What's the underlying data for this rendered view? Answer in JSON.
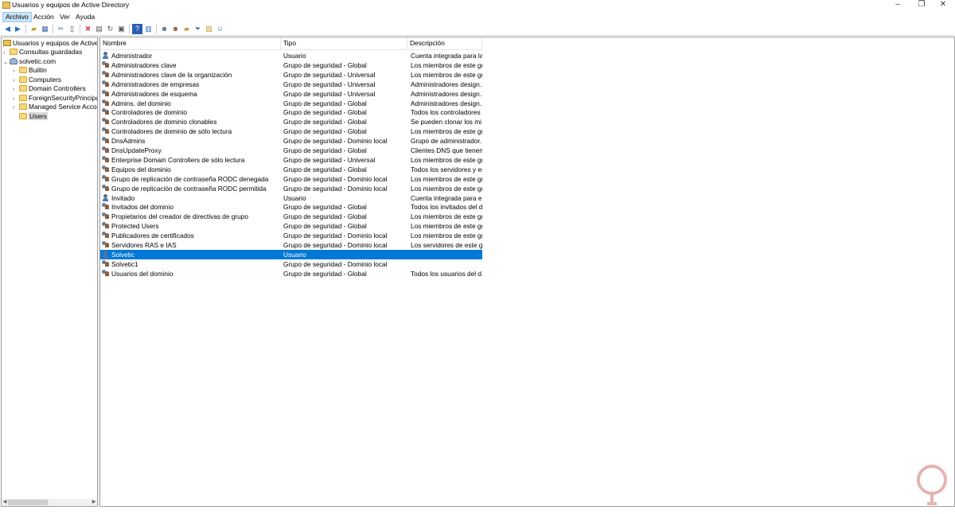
{
  "window": {
    "title": "Usuarios y equipos de Active Directory"
  },
  "menu": [
    "Archivo",
    "Acción",
    "Ver",
    "Ayuda"
  ],
  "tree": {
    "root": "Usuarios y equipos de Active Directory",
    "saved_queries": "Consultas guardadas",
    "domain": "solvetic.com",
    "children": [
      "Builtin",
      "Computers",
      "Domain Controllers",
      "ForeignSecurityPrincipals",
      "Managed Service Accounts",
      "Users"
    ],
    "selected": "Users"
  },
  "columns": [
    "Nombre",
    "Tipo",
    "Descripción"
  ],
  "rows": [
    {
      "icon": "user-icon",
      "name": "Administrador",
      "type": "Usuario",
      "desc": "Cuenta integrada para la..."
    },
    {
      "icon": "group-icon",
      "name": "Administradores clave",
      "type": "Grupo de seguridad - Global",
      "desc": "Los miembros de este gr..."
    },
    {
      "icon": "group-icon",
      "name": "Administradores clave de la organización",
      "type": "Grupo de seguridad - Universal",
      "desc": "Los miembros de este gr..."
    },
    {
      "icon": "group-icon",
      "name": "Administradores de empresas",
      "type": "Grupo de seguridad - Universal",
      "desc": "Administradores design..."
    },
    {
      "icon": "group-icon",
      "name": "Administradores de esquema",
      "type": "Grupo de seguridad - Universal",
      "desc": "Administradores design..."
    },
    {
      "icon": "group-icon",
      "name": "Admins. del dominio",
      "type": "Grupo de seguridad - Global",
      "desc": "Administradores design..."
    },
    {
      "icon": "group-icon",
      "name": "Controladores de dominio",
      "type": "Grupo de seguridad - Global",
      "desc": "Todos los controladores ..."
    },
    {
      "icon": "group-icon",
      "name": "Controladores de dominio clonables",
      "type": "Grupo de seguridad - Global",
      "desc": "Se pueden clonar los mi..."
    },
    {
      "icon": "group-icon",
      "name": "Controladores de dominio de sólo lectura",
      "type": "Grupo de seguridad - Global",
      "desc": "Los miembros de este gr..."
    },
    {
      "icon": "group-icon",
      "name": "DnsAdmins",
      "type": "Grupo de seguridad - Dominio local",
      "desc": "Grupo de administrador..."
    },
    {
      "icon": "group-icon",
      "name": "DnsUpdateProxy",
      "type": "Grupo de seguridad - Global",
      "desc": "Clientes DNS que tienen..."
    },
    {
      "icon": "group-icon",
      "name": "Enterprise Domain Controllers de sólo lectura",
      "type": "Grupo de seguridad - Universal",
      "desc": "Los miembros de este gr..."
    },
    {
      "icon": "group-icon",
      "name": "Equipos del dominio",
      "type": "Grupo de seguridad - Global",
      "desc": "Todos los servidores y es..."
    },
    {
      "icon": "group-icon",
      "name": "Grupo de replicación de contraseña RODC denegada",
      "type": "Grupo de seguridad - Dominio local",
      "desc": "Los miembros de este gr..."
    },
    {
      "icon": "group-icon",
      "name": "Grupo de replicación de contraseña RODC permitida",
      "type": "Grupo de seguridad - Dominio local",
      "desc": "Los miembros de este gr..."
    },
    {
      "icon": "user-icon",
      "name": "Invitado",
      "type": "Usuario",
      "desc": "Cuenta integrada para el..."
    },
    {
      "icon": "group-icon",
      "name": "Invitados del dominio",
      "type": "Grupo de seguridad - Global",
      "desc": "Todos los invitados del d..."
    },
    {
      "icon": "group-icon",
      "name": "Propietarios del creador de directivas de grupo",
      "type": "Grupo de seguridad - Global",
      "desc": "Los miembros de este gr..."
    },
    {
      "icon": "group-icon",
      "name": "Protected Users",
      "type": "Grupo de seguridad - Global",
      "desc": "Los miembros de este gr..."
    },
    {
      "icon": "group-icon",
      "name": "Publicadores de certificados",
      "type": "Grupo de seguridad - Dominio local",
      "desc": "Los miembros de este gr..."
    },
    {
      "icon": "group-icon",
      "name": "Servidores RAS e IAS",
      "type": "Grupo de seguridad - Dominio local",
      "desc": "Los servidores de este gr..."
    },
    {
      "icon": "user-icon",
      "name": "Solvetic",
      "type": "Usuario",
      "desc": "",
      "selected": true
    },
    {
      "icon": "group-icon",
      "name": "Solvetic1",
      "type": "Grupo de seguridad - Dominio local",
      "desc": ""
    },
    {
      "icon": "group-icon",
      "name": "Usuarios del dominio",
      "type": "Grupo de seguridad - Global",
      "desc": "Todos los usuarios del d..."
    }
  ],
  "colors": {
    "selection": "#0078d7",
    "accent_folder": "#f6d77a"
  }
}
